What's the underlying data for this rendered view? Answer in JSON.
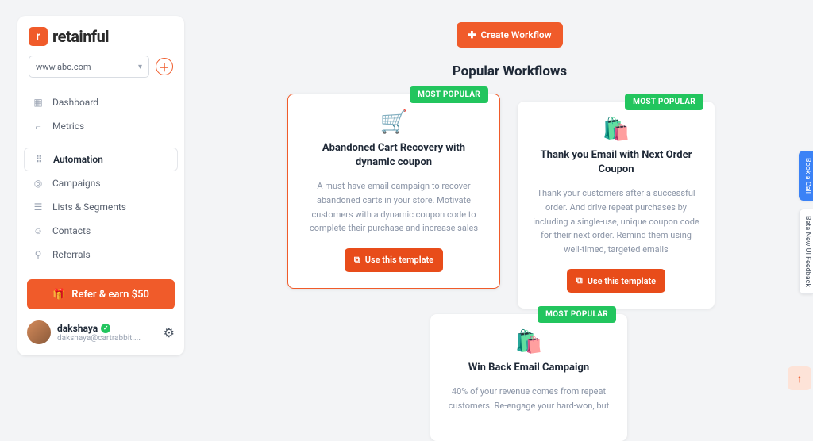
{
  "brand": {
    "name": "retainful",
    "badge_glyph": "r"
  },
  "domain_selector": {
    "value": "www.abc.com"
  },
  "nav": {
    "dashboard": "Dashboard",
    "metrics": "Metrics",
    "automation": "Automation",
    "campaigns": "Campaigns",
    "lists": "Lists & Segments",
    "contacts": "Contacts",
    "referrals": "Referrals"
  },
  "refer_cta": "Refer & earn $50",
  "user": {
    "name": "dakshaya",
    "email": "dakshaya@cartrabbit...."
  },
  "header": {
    "create_label": "Create Workflow",
    "section_title": "Popular Workflows"
  },
  "badge_text": "MOST POPULAR",
  "use_template_label": "Use this template",
  "cards": [
    {
      "icon": "🛒",
      "title": "Abandoned Cart Recovery with dynamic coupon",
      "desc": "A must-have email campaign to recover abandoned carts in your store. Motivate customers with a dynamic coupon code to complete their purchase and increase sales"
    },
    {
      "icon": "🛍️",
      "title": "Thank you Email with Next Order Coupon",
      "desc": "Thank your customers after a successful order. And drive repeat purchases by including a single-use, unique coupon code for their next order. Remind them using well-timed, targeted emails"
    },
    {
      "icon": "🛍️",
      "title": "Win Back Email Campaign",
      "desc": "40% of your revenue comes from repeat customers. Re-engage your hard-won, but"
    }
  ],
  "rail": {
    "book_call": "Book a Call",
    "feedback": "Beta New UI Feedback"
  }
}
